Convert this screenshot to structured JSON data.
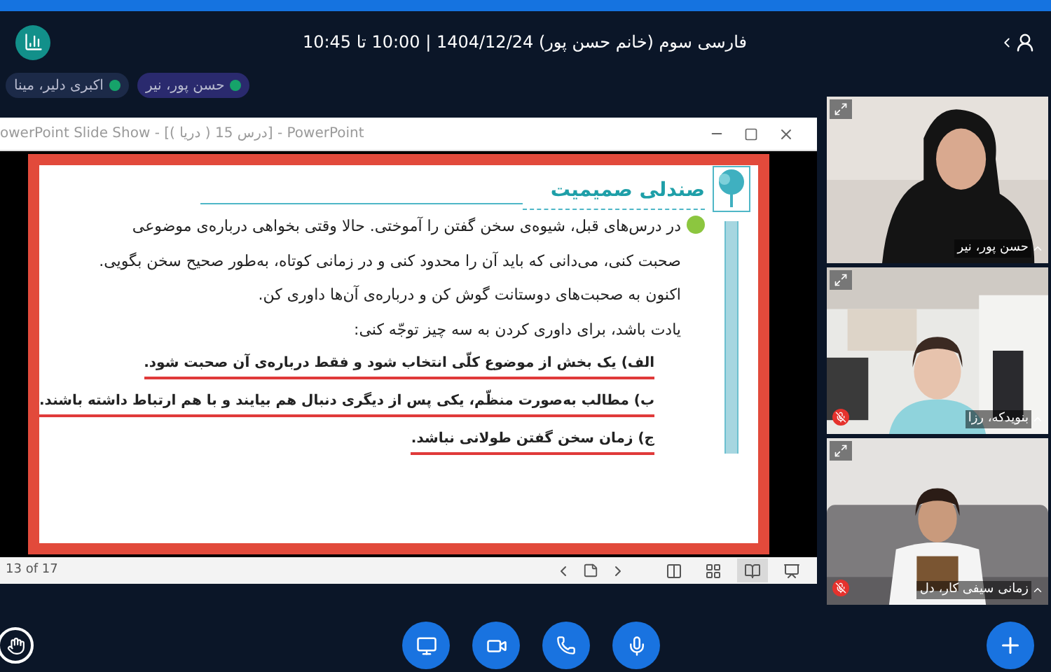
{
  "header": {
    "title": "فارسی سوم (خانم حسن پور) 1404/12/24 | 10:00 تا 10:45"
  },
  "chips": [
    {
      "label": "حسن پور، نیر",
      "selected": true
    },
    {
      "label": "اکبری دلیر، مینا",
      "selected": false
    }
  ],
  "slide_window": {
    "title": "owerPoint Slide Show - [درس 15 ( دریا )] - PowerPoint",
    "heading": "صندلی صمیمیت",
    "paragraph": [
      "در درس‌های قبل، شیوه‌ی سخن گفتن را آموختی. حالا وقتی بخواهی درباره‌ی موضوعی",
      "صحبت کنی، می‌دانی که باید آن را محدود کنی و در زمانی کوتاه، به‌طور صحیح سخن بگویی.",
      "اکنون به صحبت‌های دوستانت گوش کن و درباره‌ی آن‌ها داوری کن.",
      "یادت باشد، برای داوری کردن به سه چیز توجّه کنی:"
    ],
    "points": [
      "الف) یک بخش از موضوع کلّی انتخاب شود و فقط درباره‌ی آن صحبت شود.",
      "ب) مطالب به‌صورت منظّم، یکی پس از دیگری دنبال هم بیایند و با هم ارتباط داشته باشند.",
      "ج) زمان سخن گفتن طولانی نباشد."
    ],
    "slide_counter": "13 of 17",
    "views": [
      {
        "kind": "normal",
        "selected": false
      },
      {
        "kind": "sorter",
        "selected": false
      },
      {
        "kind": "reading",
        "selected": true
      },
      {
        "kind": "slideshow",
        "selected": false
      }
    ]
  },
  "participants": [
    {
      "name": "حسن پور، نیر",
      "muted": false,
      "kind": "woman"
    },
    {
      "name": "بنویدکه، رزا",
      "muted": true,
      "kind": "room"
    },
    {
      "name": "زمانی سیفی کار، دل",
      "muted": true,
      "kind": "sofa"
    }
  ]
}
